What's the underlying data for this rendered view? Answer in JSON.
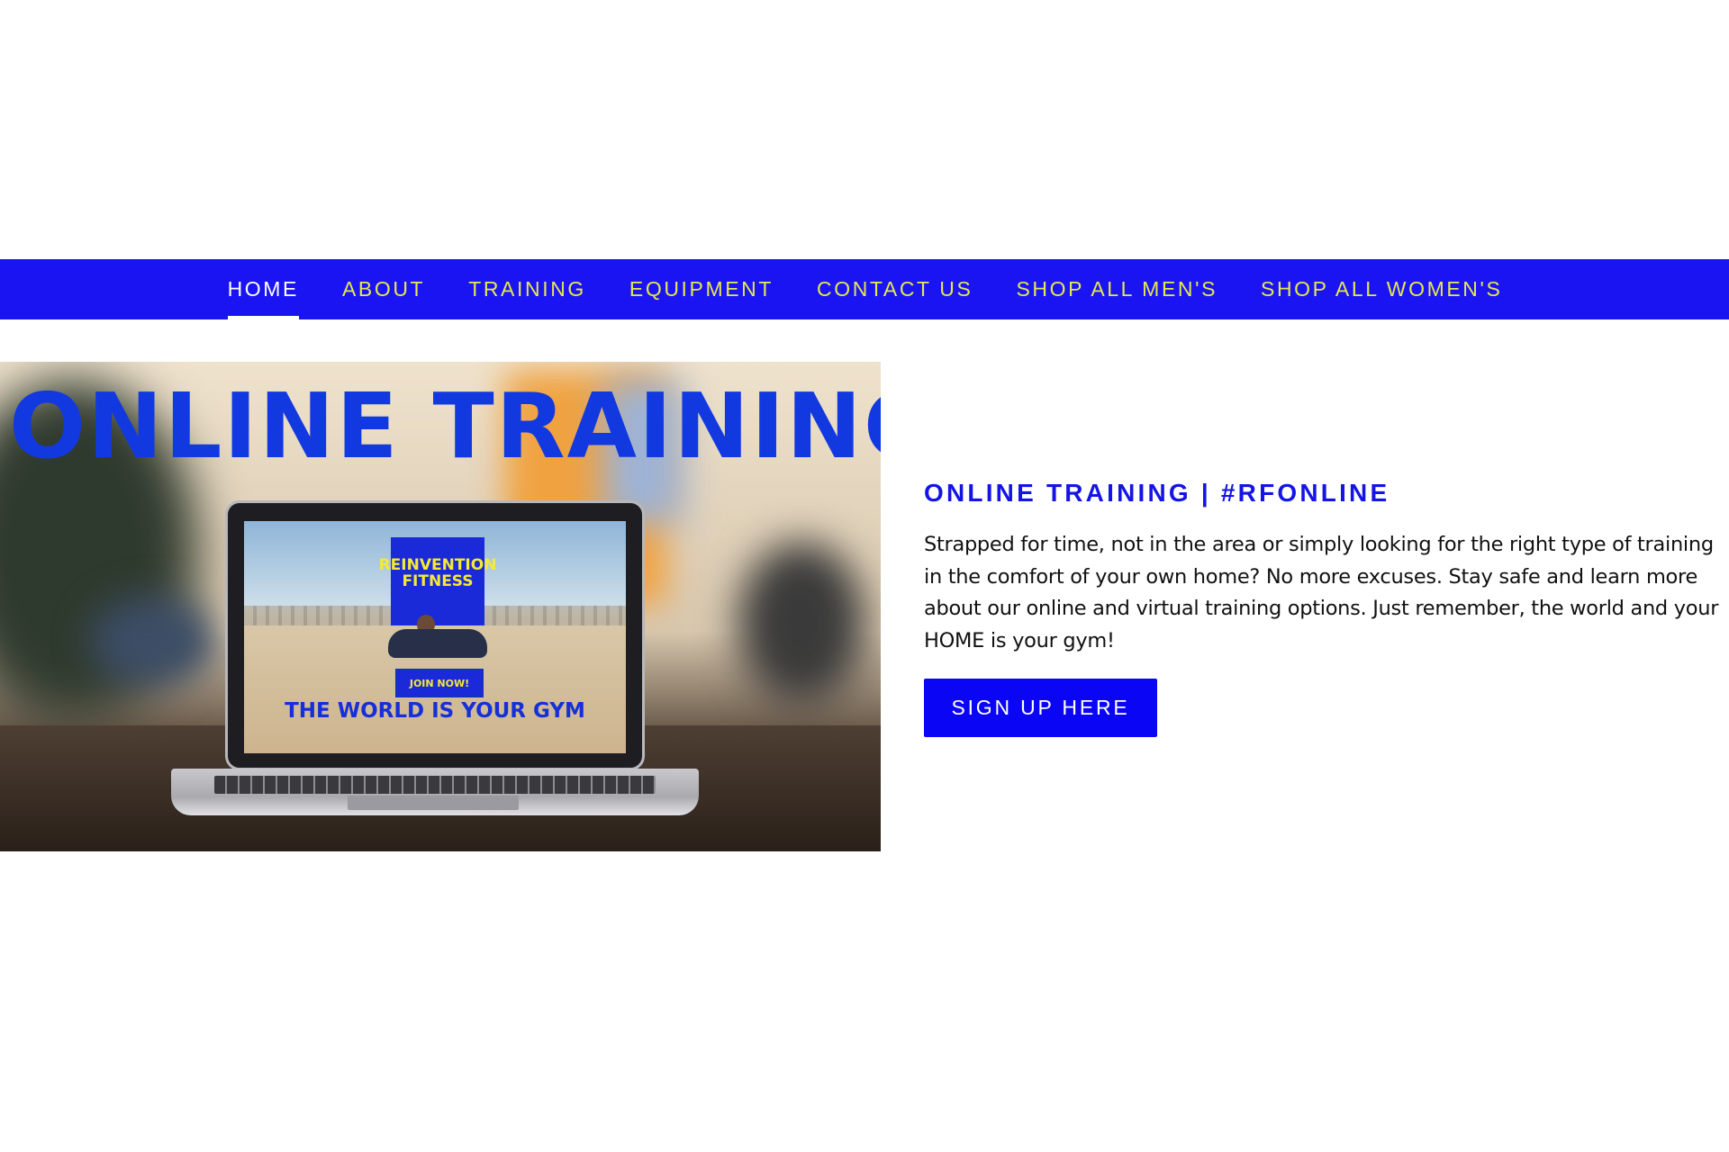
{
  "nav": {
    "items": [
      {
        "label": "HOME",
        "active": true
      },
      {
        "label": "ABOUT"
      },
      {
        "label": "TRAINING"
      },
      {
        "label": "EQUIPMENT"
      },
      {
        "label": "CONTACT US"
      },
      {
        "label": "SHOP ALL MEN'S"
      },
      {
        "label": "SHOP ALL WOMEN'S"
      }
    ]
  },
  "hero": {
    "title": "ONLINE TRAINING",
    "screen_logo": "REINVENTION FITNESS",
    "screen_button": "JOIN NOW!",
    "screen_tagline": "THE WORLD IS YOUR GYM"
  },
  "content": {
    "title": "ONLINE TRAINING | #RFONLINE",
    "body": "Strapped for time, not in the area or simply looking for the right type of training in the comfort of your own home? No more excuses. Stay safe and learn more about our online and virtual training options. Just remember, the world and your HOME is your gym!",
    "cta_label": "SIGN UP HERE"
  },
  "colors": {
    "nav_background": "#1a14f2",
    "nav_text": "#e6e84e",
    "nav_active_text": "#ffffff",
    "accent": "#0a05f5",
    "hero_title": "#1239e0"
  }
}
